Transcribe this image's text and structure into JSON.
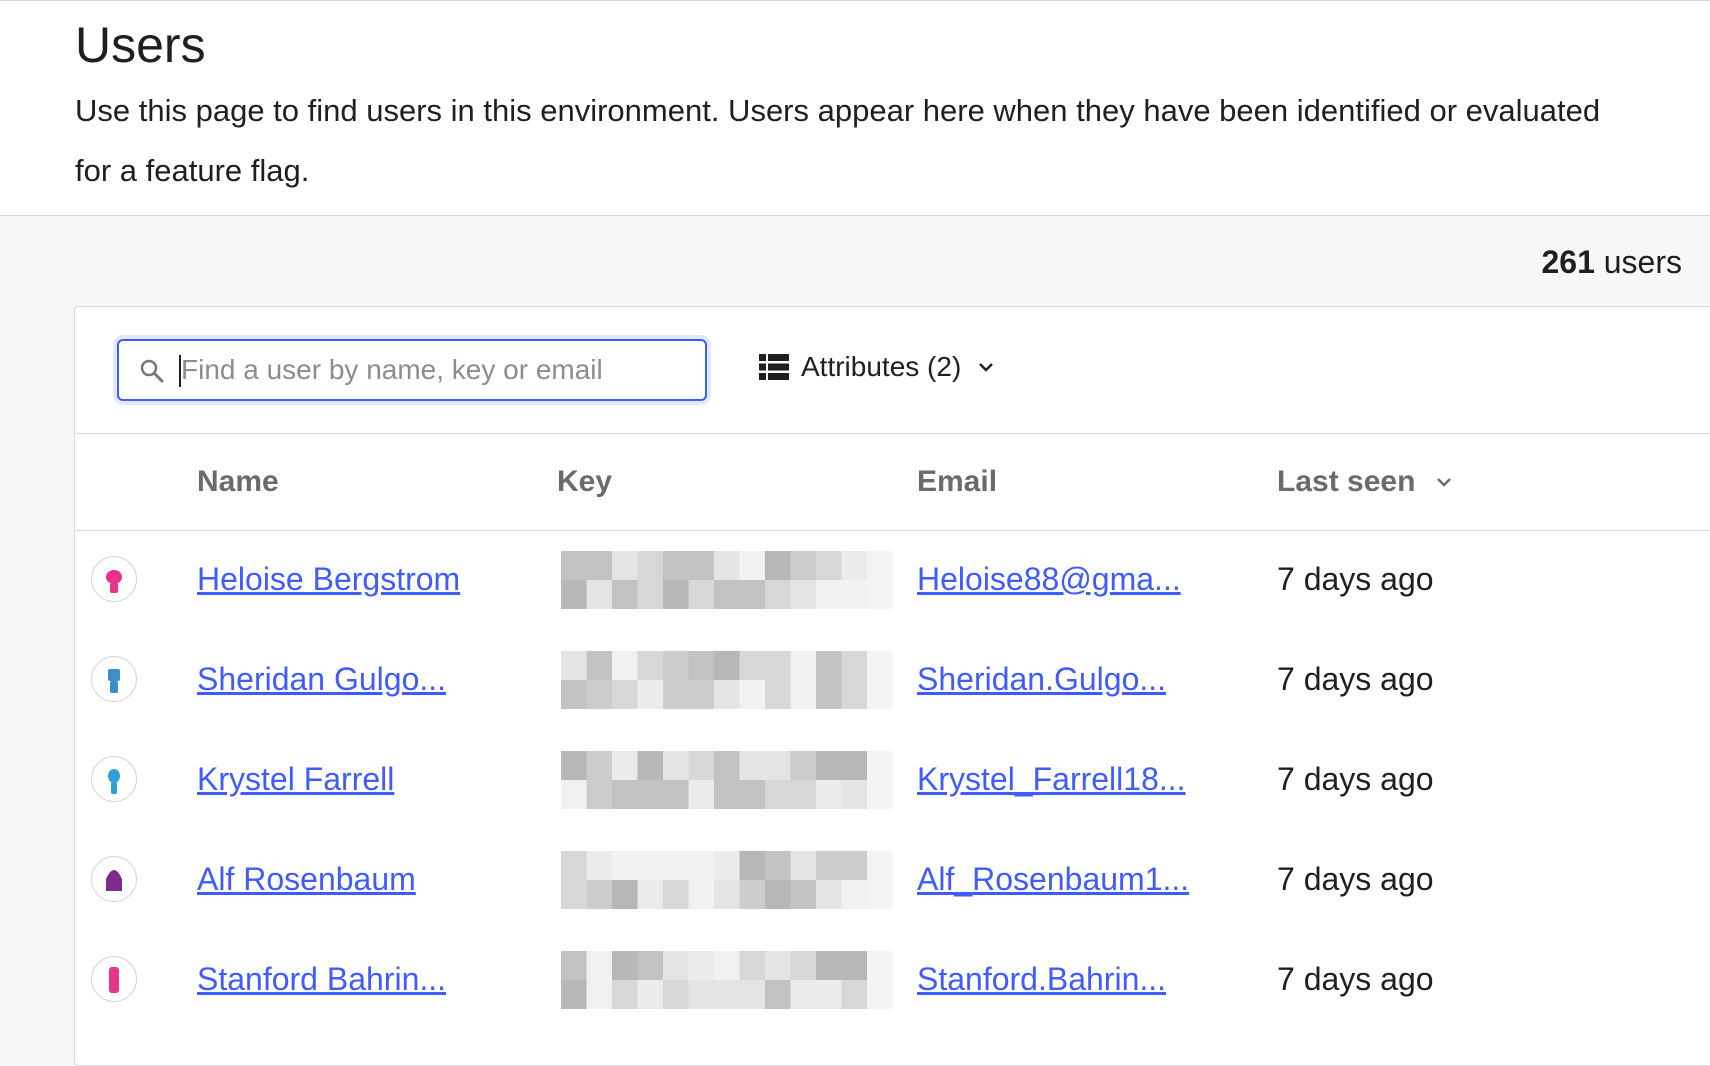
{
  "header": {
    "title": "Users",
    "description": "Use this page to find users in this environment. Users appear here when they have been identified or evaluated for a feature flag."
  },
  "user_count": {
    "number": "261",
    "label": "users"
  },
  "search": {
    "placeholder": "Find a user by name, key or email",
    "value": ""
  },
  "attributes_button": {
    "label": "Attributes (2)",
    "icon": "list-icon"
  },
  "table": {
    "columns": {
      "name": "Name",
      "key": "Key",
      "email": "Email",
      "last_seen": "Last seen"
    },
    "rows": [
      {
        "name": "Heloise Bergstrom",
        "email": "Heloise88@gma...",
        "last_seen": "7 days ago",
        "avatar_color": "#e8338b"
      },
      {
        "name": "Sheridan Gulgo...",
        "email": "Sheridan.Gulgo...",
        "last_seen": "7 days ago",
        "avatar_color": "#3a8fc9"
      },
      {
        "name": "Krystel Farrell",
        "email": "Krystel_Farrell18...",
        "last_seen": "7 days ago",
        "avatar_color": "#2f9fd6"
      },
      {
        "name": "Alf Rosenbaum",
        "email": "Alf_Rosenbaum1...",
        "last_seen": "7 days ago",
        "avatar_color": "#7b2d8e"
      },
      {
        "name": "Stanford Bahrin...",
        "email": "Stanford.Bahrin...",
        "last_seen": "7 days ago",
        "avatar_color": "#e8338b"
      }
    ]
  },
  "colors": {
    "link": "#405bff",
    "focus": "#405bff"
  }
}
